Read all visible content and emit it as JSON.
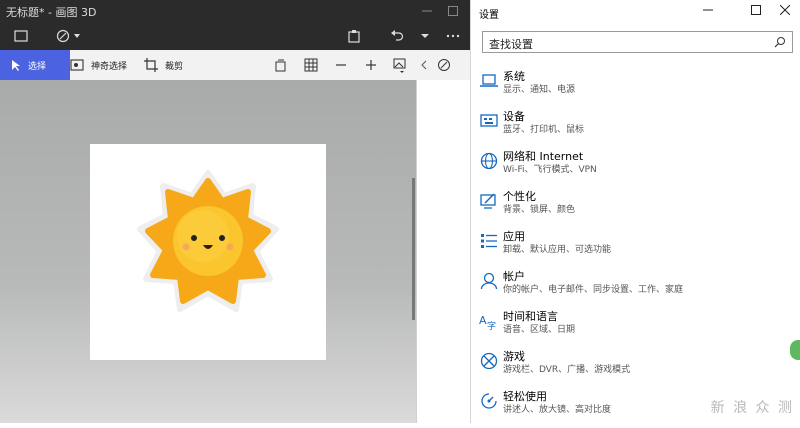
{
  "paint": {
    "title": "无标题* - 画图 3D",
    "ribbon": {
      "select": "选择",
      "magic_select": "神奇选择",
      "crop": "裁剪"
    }
  },
  "settings": {
    "title": "设置",
    "search_placeholder": "查找设置",
    "items": [
      {
        "name": "系统",
        "desc": "显示、通知、电源",
        "icon": "laptop-icon"
      },
      {
        "name": "设备",
        "desc": "蓝牙、打印机、鼠标",
        "icon": "keyboard-icon"
      },
      {
        "name": "网络和 Internet",
        "desc": "Wi-Fi、飞行模式、VPN",
        "icon": "globe-icon"
      },
      {
        "name": "个性化",
        "desc": "背景、锁屏、颜色",
        "icon": "brush-icon"
      },
      {
        "name": "应用",
        "desc": "卸载、默认应用、可选功能",
        "icon": "apps-list-icon"
      },
      {
        "name": "帐户",
        "desc": "你的帐户、电子邮件、同步设置、工作、家庭",
        "icon": "person-icon"
      },
      {
        "name": "时间和语言",
        "desc": "语音、区域、日期",
        "icon": "time-language-icon"
      },
      {
        "name": "游戏",
        "desc": "游戏栏、DVR、广播、游戏模式",
        "icon": "xbox-icon"
      },
      {
        "name": "轻松使用",
        "desc": "讲述人、放大镜、高对比度",
        "icon": "ease-of-access-icon"
      }
    ]
  },
  "watermark": "新 浪 众 测",
  "colors": {
    "accent": "#1469c2",
    "paint_select": "#4b63e0",
    "sun": "#f7b21d"
  }
}
